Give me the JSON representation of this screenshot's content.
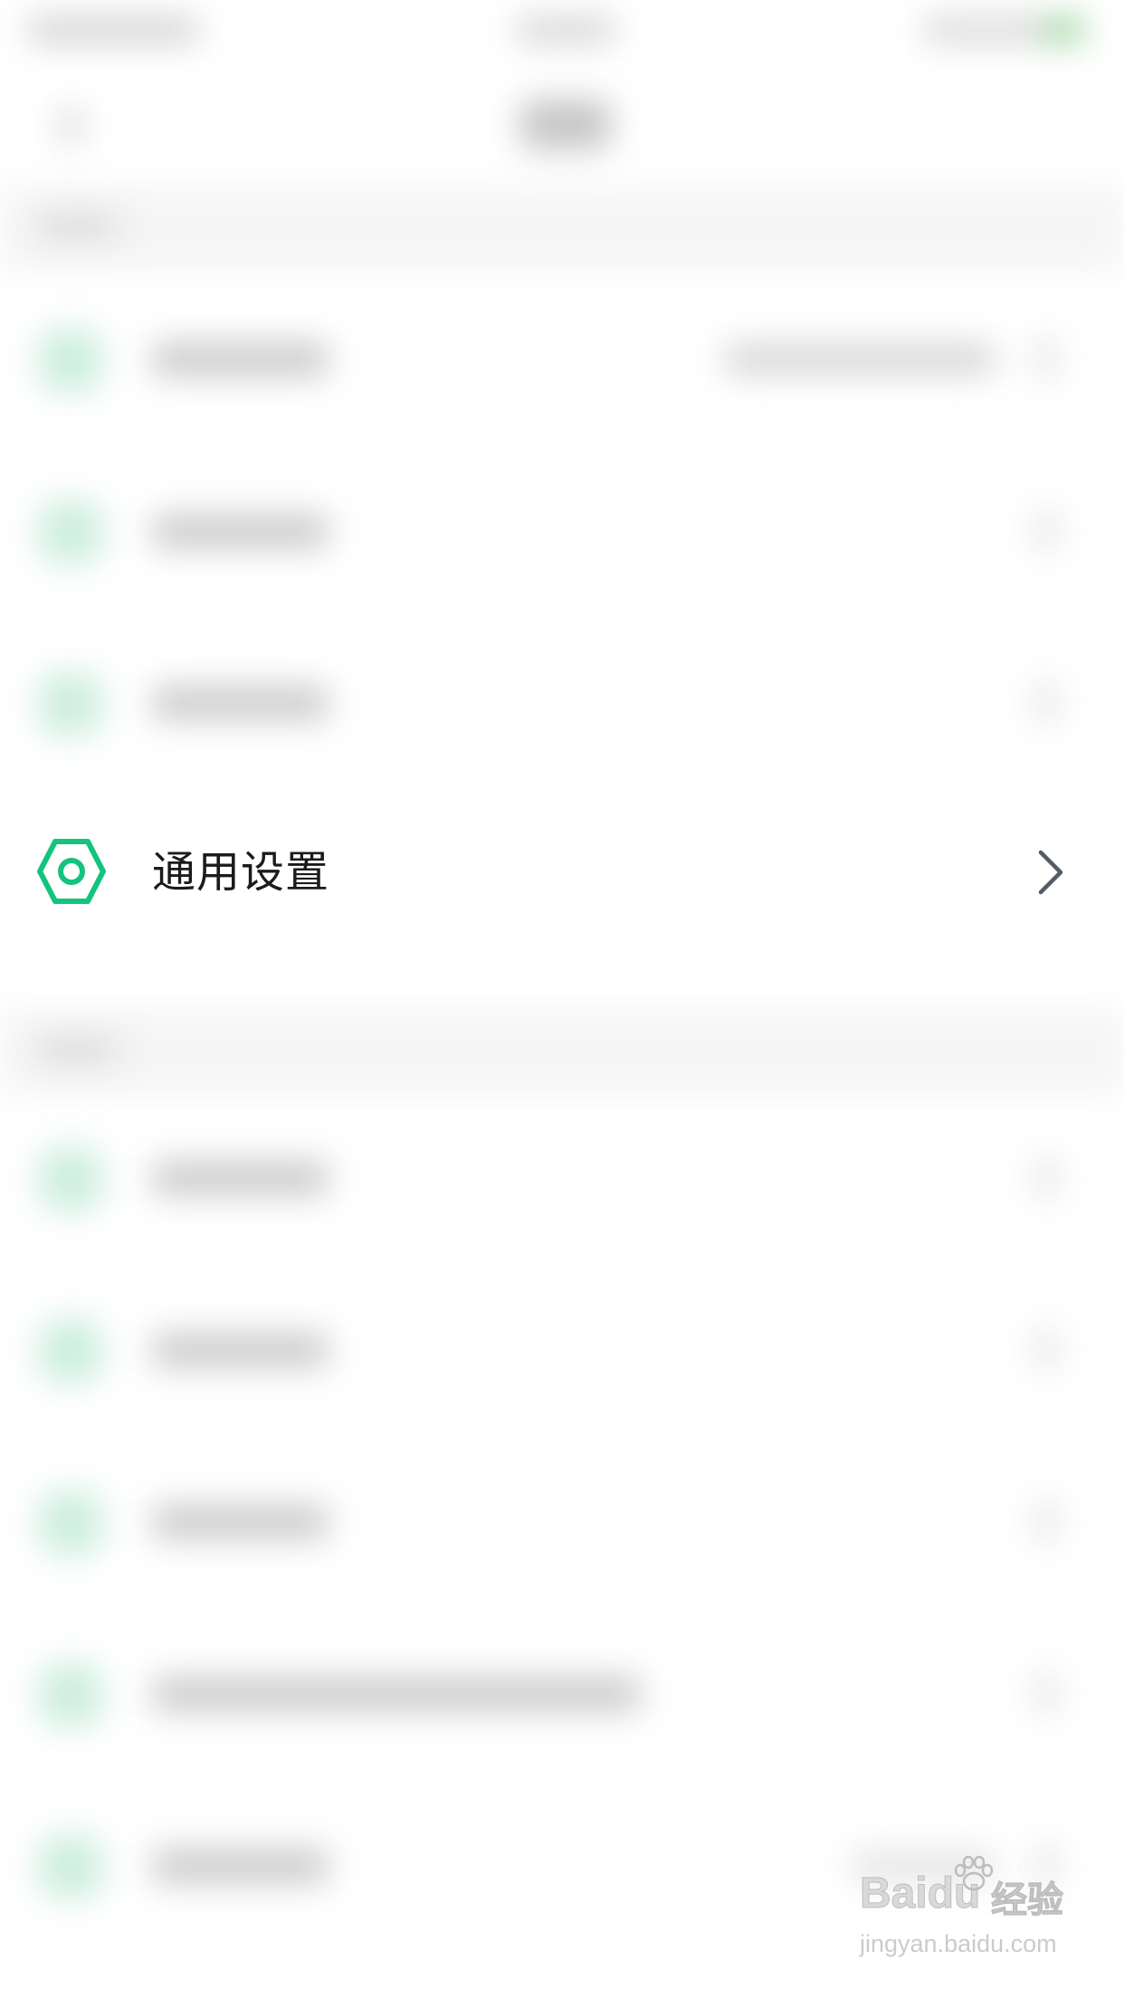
{
  "focused_setting": {
    "label": "通用设置",
    "icon": "gear-icon",
    "chevron_icon": "chevron-right-icon"
  },
  "watermark": {
    "brand": "Bai",
    "brand_tail": "du",
    "brand_cn": "经验",
    "url": "jingyan.baidu.com"
  },
  "colors": {
    "accent": "#15C27E",
    "text": "#1B1B1B",
    "chevron": "#545C66",
    "section_bg": "#F4F4F5"
  }
}
